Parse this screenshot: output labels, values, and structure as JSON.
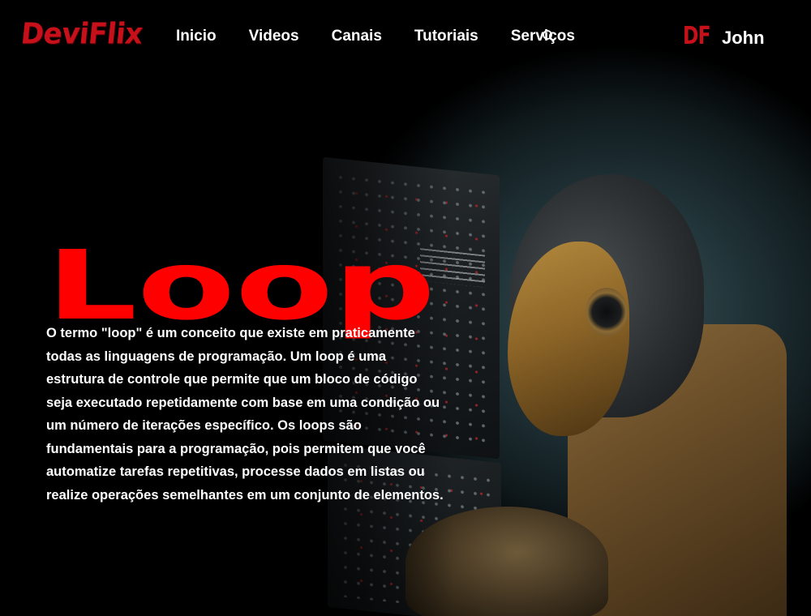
{
  "brand": {
    "logo_text": "DeviFlix",
    "logo_color": "#c8101a",
    "mark_text": "DF"
  },
  "nav": {
    "items": [
      {
        "label": "Inicio"
      },
      {
        "label": "Videos"
      },
      {
        "label": "Canais"
      },
      {
        "label": "Tutoriais"
      },
      {
        "label": "Serviços"
      }
    ],
    "search_icon": "search-icon"
  },
  "user": {
    "name": "John"
  },
  "hero": {
    "title": "Loop",
    "title_color": "#ff0000",
    "description": "O termo \"loop\" é um conceito que existe em praticamente todas as linguagens de programação. Um loop é uma estrutura de controle que permite que um bloco de código seja executado repetidamente com base em uma condição ou um número de iterações específico. Os loops são fundamentais para a programação, pois permitem que você automatize tarefas repetitivas, processe dados em listas ou realize operações semelhantes em um conjunto de elementos."
  }
}
